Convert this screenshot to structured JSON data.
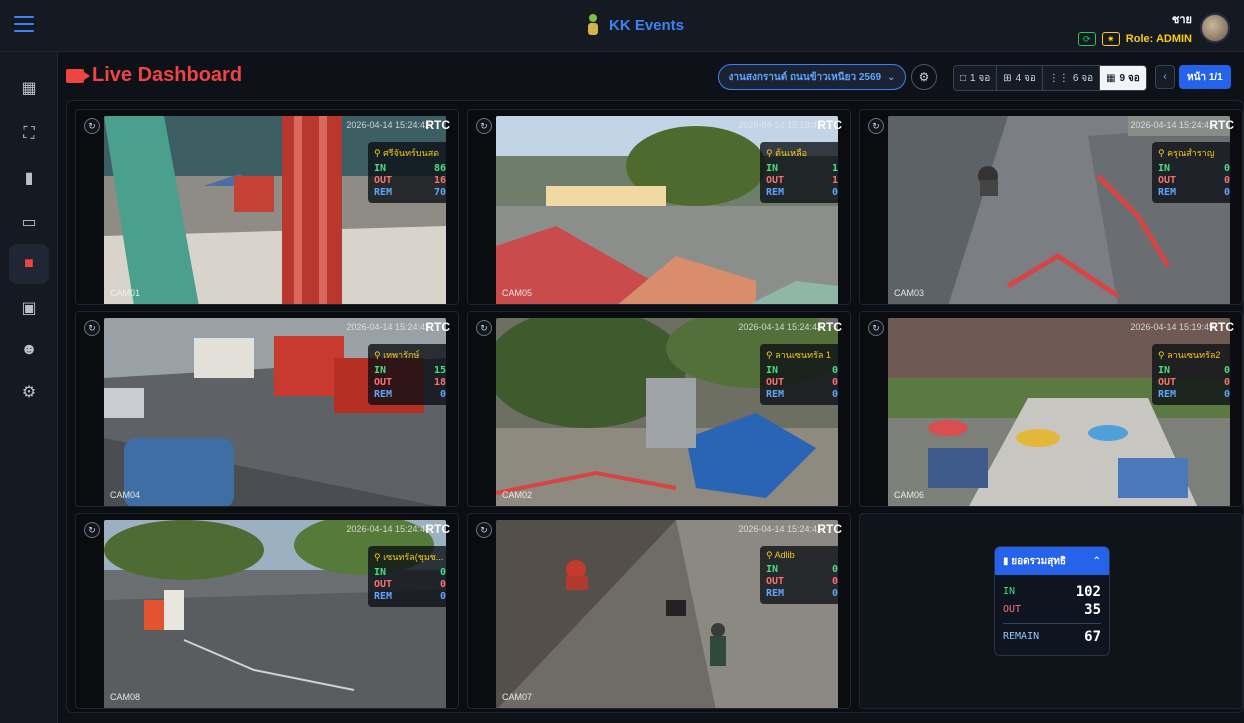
{
  "topbar": {
    "brand": "KK Events",
    "user_name": "ชาย",
    "role": "Role: ADMIN"
  },
  "header": {
    "title": "Live Dashboard",
    "event_select": "งานสงกรานต์ ถนนข้าวเหนียว 2569",
    "layout_options": [
      "1 จอ",
      "4 จอ",
      "6 จอ",
      "9 จอ"
    ],
    "active_layout": "9 จอ",
    "page_label": "หน้า 1/1"
  },
  "cameras": [
    {
      "location": "ศรีจันทร์บนสด",
      "timestamp": "2026-04-14 15:24:42",
      "label": "CAM01",
      "in": "86",
      "out": "16",
      "rem": "70"
    },
    {
      "location": "ต้นเหลือ",
      "timestamp": "2026-04-14 15:18:48",
      "label": "CAM05",
      "in": "1",
      "out": "1",
      "rem": "0"
    },
    {
      "location": "ครุณสำราญ",
      "timestamp": "2026-04-14 15:24:41",
      "label": "CAM03",
      "in": "0",
      "out": "0",
      "rem": "0"
    },
    {
      "location": "เทพารักษ์",
      "timestamp": "2026-04-14 15:24:42",
      "label": "CAM04",
      "in": "15",
      "out": "18",
      "rem": "0"
    },
    {
      "location": "ลานเซนทรัล 1",
      "timestamp": "2026-04-14 15:24:43",
      "label": "CAM02",
      "in": "0",
      "out": "0",
      "rem": "0"
    },
    {
      "location": "ลานเซนทรัล2",
      "timestamp": "2026-04-14 15:19:49",
      "label": "CAM06",
      "in": "0",
      "out": "0",
      "rem": "0"
    },
    {
      "location": "เซนทรัล(ชุมช...",
      "timestamp": "2026-04-14 15:24:43",
      "label": "CAM08",
      "in": "0",
      "out": "0",
      "rem": "0"
    },
    {
      "location": "Adlib",
      "timestamp": "2026-04-14 15:24:41",
      "label": "CAM07",
      "in": "0",
      "out": "0",
      "rem": "0"
    }
  ],
  "counter_labels": {
    "in": "IN",
    "out": "OUT",
    "rem": "REM",
    "rtc": "RTC"
  },
  "summary": {
    "title": "ยอดรวมสุทธิ",
    "in_label": "IN",
    "in_value": "102",
    "out_label": "OUT",
    "out_value": "35",
    "remain_label": "REMAIN",
    "remain_value": "67"
  },
  "colors": {
    "accent": "#3b82f6",
    "danger": "#ef4444",
    "in": "#4ade80",
    "out": "#f87171",
    "rem": "#60a5fa",
    "location": "#facc15"
  }
}
